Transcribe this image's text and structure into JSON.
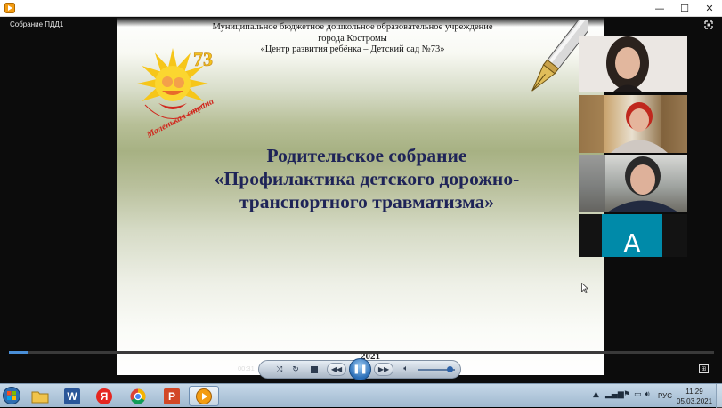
{
  "window": {
    "controls": {
      "minimize": "—",
      "maximize": "☐",
      "close": "✕"
    }
  },
  "player": {
    "media_title": "Собрание ПДД1",
    "current_time": "00:31",
    "progress_fraction": 0.028,
    "volume_fraction": 0.85,
    "accent_color": "#4a8fd8"
  },
  "slide": {
    "org_lines": [
      "Муниципальное бюджетное дошкольное образовательное учреждение",
      "города Костромы",
      "«Центр развития ребёнка – Детский сад №73»"
    ],
    "logo": {
      "number": "73",
      "caption": "Маленькая страна"
    },
    "heading_lines": [
      "Родительское собрание",
      "«Профилактика детского дорожно-",
      "транспортного травматизма»"
    ],
    "year": "2021",
    "heading_color": "#1f2458"
  },
  "participants": {
    "avatar_letter": "A",
    "avatar_color": "#008aa9"
  },
  "taskbar": {
    "apps": [
      {
        "name": "explorer-icon"
      },
      {
        "name": "word-icon",
        "glyph": "W"
      },
      {
        "name": "yandex-icon",
        "glyph": "Я"
      },
      {
        "name": "chrome-icon"
      },
      {
        "name": "powerpoint-icon",
        "glyph": "P"
      },
      {
        "name": "media-player-icon"
      }
    ],
    "language": "РУС",
    "time": "11:29",
    "date": "05.03.2021"
  }
}
